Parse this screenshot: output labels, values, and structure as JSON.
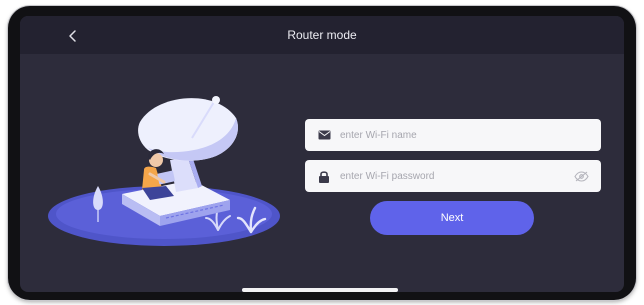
{
  "header": {
    "title": "Router mode",
    "back_icon": "chevron-left-icon"
  },
  "form": {
    "wifi_name": {
      "value": "",
      "placeholder": "enter Wi-Fi name",
      "icon": "mail-icon"
    },
    "wifi_password": {
      "value": "",
      "placeholder": "enter Wi-Fi password",
      "icon": "lock-icon",
      "toggle_icon": "eye-off-icon"
    },
    "next_label": "Next"
  },
  "colors": {
    "screen_bg": "#2d2c3b",
    "header_bg": "#232230",
    "accent": "#5f63ea",
    "field_bg": "#f7f7f9",
    "placeholder": "#a6a6ae"
  }
}
